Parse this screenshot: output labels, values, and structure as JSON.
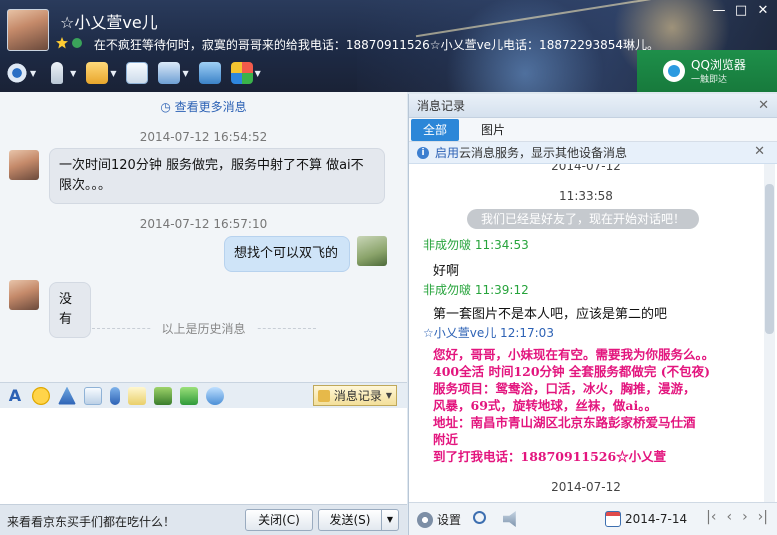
{
  "window": {
    "contact_name": "☆小乂萱ve儿",
    "signature": "在不疯狂等待何时，寂寞的哥哥来的给我电话：18870911526☆小乂萱ve儿电话：18872293854琳儿。",
    "controls": [
      "—",
      "□",
      "✕"
    ]
  },
  "toolbar": {
    "items": [
      "camera-icon",
      "mic-icon",
      "folder-transfer-icon",
      "sms-icon",
      "remote-assist-icon",
      "screen-share-icon",
      "apps-grid-icon"
    ]
  },
  "ad_qqbrowser": {
    "title": "QQ浏览器",
    "subtitle": "一触即达"
  },
  "chat": {
    "more_messages": "查看更多消息",
    "history_label": "以上是历史消息",
    "messages": [
      {
        "time": "2014-07-12 16:54:52",
        "side": "in",
        "text": "一次时间120分钟 服务做完，服务中射了不算 做ai不限次。。。"
      },
      {
        "time": "2014-07-12 16:57:10",
        "side": "out",
        "text": "想找个可以双飞的"
      },
      {
        "side": "in",
        "text": "没有"
      }
    ]
  },
  "format_bar": {
    "items": [
      "font-icon",
      "emoji-icon",
      "shake-icon",
      "gift-icon",
      "voice-icon",
      "note-icon",
      "image-icon",
      "screenshot-icon",
      "bubble-icon"
    ],
    "message_record_label": "消息记录"
  },
  "footer": {
    "ad_text": "来看看京东买手们都在吃什么！",
    "close_label": "关闭(C)",
    "send_label": "发送(S)"
  },
  "history_panel": {
    "title": "消息记录",
    "tabs": [
      "全部",
      "图片"
    ],
    "cloud_notice_link": "启用",
    "cloud_notice_text": "云消息服务，显示其他设备消息",
    "entries": {
      "top_time": "2014-07-12",
      "time2": "11:33:58",
      "pill": "我们已经是好友了，现在开始对话吧！",
      "s1": "非成勿啵 11:34:53",
      "t1": "好啊",
      "s2": "非成勿啵 11:39:12",
      "t2": "第一套图片不是本人吧，应该是第二的吧",
      "s3": "☆小乂萱ve儿 12:17:03",
      "promo": [
        "您好，哥哥，小妹现在有空。需要我为你服务么。。",
        "400全活 时间120分钟  全套服务都做完 (不包夜)",
        "服务项目：鸳鸯浴，口活，冰火，胸推，漫游，",
        "风暴，69式，旋转地球，丝袜，做ai。。",
        " 地址：南昌市青山湖区北京东路彭家桥爱马仕酒",
        "附近",
        "到了打我电话：18870911526☆小乂萱"
      ],
      "bottom_time": "2014-07-12"
    },
    "footer": {
      "settings_label": "设置",
      "date": "2014-7-14"
    }
  }
}
